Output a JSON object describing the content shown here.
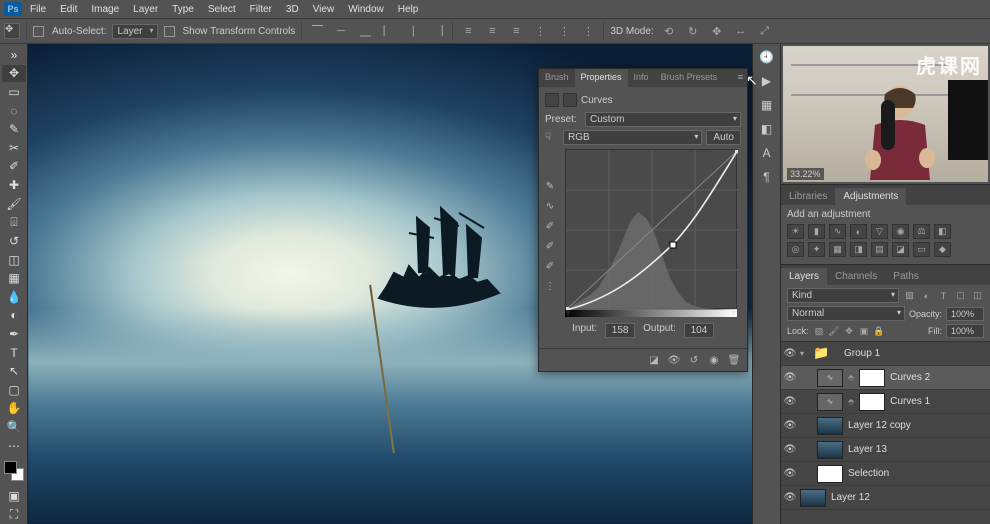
{
  "app_logo": "Ps",
  "menu": [
    "File",
    "Edit",
    "Image",
    "Layer",
    "Type",
    "Select",
    "Filter",
    "3D",
    "View",
    "Window",
    "Help"
  ],
  "options": {
    "auto_select_label": "Auto-Select:",
    "target": "Layer",
    "show_transform_label": "Show Transform Controls",
    "mode_label": "3D Mode:"
  },
  "zoom_preview": "33.22%",
  "watermark": "虎课网",
  "right_tabs": {
    "libraries": "Libraries",
    "adjustments": "Adjustments"
  },
  "adjust_label": "Add an adjustment",
  "layers_tabs": {
    "layers": "Layers",
    "channels": "Channels",
    "paths": "Paths"
  },
  "layer_controls": {
    "kind": "Kind",
    "blend": "Normal",
    "opacity_label": "Opacity:",
    "opacity": "100%",
    "lock_label": "Lock:",
    "fill_label": "Fill:",
    "fill": "100%"
  },
  "layers": [
    {
      "name": "Group 1",
      "type": "group"
    },
    {
      "name": "Curves 2",
      "type": "curves",
      "selected": true
    },
    {
      "name": "Curves 1",
      "type": "curves"
    },
    {
      "name": "Layer 12 copy",
      "type": "image"
    },
    {
      "name": "Layer 13",
      "type": "image"
    },
    {
      "name": "Selection",
      "type": "mask"
    },
    {
      "name": "Layer 12",
      "type": "image"
    }
  ],
  "float": {
    "tabs": {
      "brush": "Brush",
      "props": "Properties",
      "info": "Info",
      "presets": "Brush Presets"
    },
    "title": "Curves",
    "preset_label": "Preset:",
    "preset": "Custom",
    "channel": "RGB",
    "auto_btn": "Auto",
    "input_label": "Input:",
    "input": "158",
    "output_label": "Output:",
    "output": "104"
  },
  "chart_data": {
    "type": "line",
    "title": "Curves",
    "xlabel": "Input",
    "ylabel": "Output",
    "xlim": [
      0,
      255
    ],
    "ylim": [
      0,
      255
    ],
    "series": [
      {
        "name": "curve",
        "values": [
          [
            0,
            0
          ],
          [
            60,
            24
          ],
          [
            120,
            58
          ],
          [
            158,
            104
          ],
          [
            200,
            170
          ],
          [
            235,
            230
          ],
          [
            255,
            255
          ]
        ]
      },
      {
        "name": "reference",
        "values": [
          [
            0,
            0
          ],
          [
            255,
            255
          ]
        ]
      }
    ],
    "selected_point": {
      "input": 158,
      "output": 104
    },
    "histogram": [
      0,
      2,
      4,
      6,
      10,
      18,
      28,
      40,
      55,
      62,
      58,
      48,
      32,
      18,
      10,
      5,
      2,
      0,
      0,
      0
    ]
  }
}
